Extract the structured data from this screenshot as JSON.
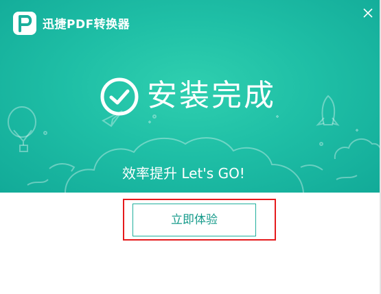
{
  "window": {
    "title": "迅捷PDF转换器",
    "logo_icon": "pdf-p-logo-icon",
    "close_icon": "close-icon"
  },
  "banner": {
    "status_title": "安装完成",
    "status_icon": "check-circle-icon",
    "slogan": "效率提升 Let's GO!",
    "decorations": [
      "hot-air-balloon-icon",
      "rocket-icon",
      "paper-plane-icon",
      "cloud-icon"
    ]
  },
  "actions": {
    "primary_label": "立即体验"
  },
  "colors": {
    "banner": "#1fbfa6",
    "accent_text": "#159a8a",
    "highlight_border": "#e5191b"
  }
}
